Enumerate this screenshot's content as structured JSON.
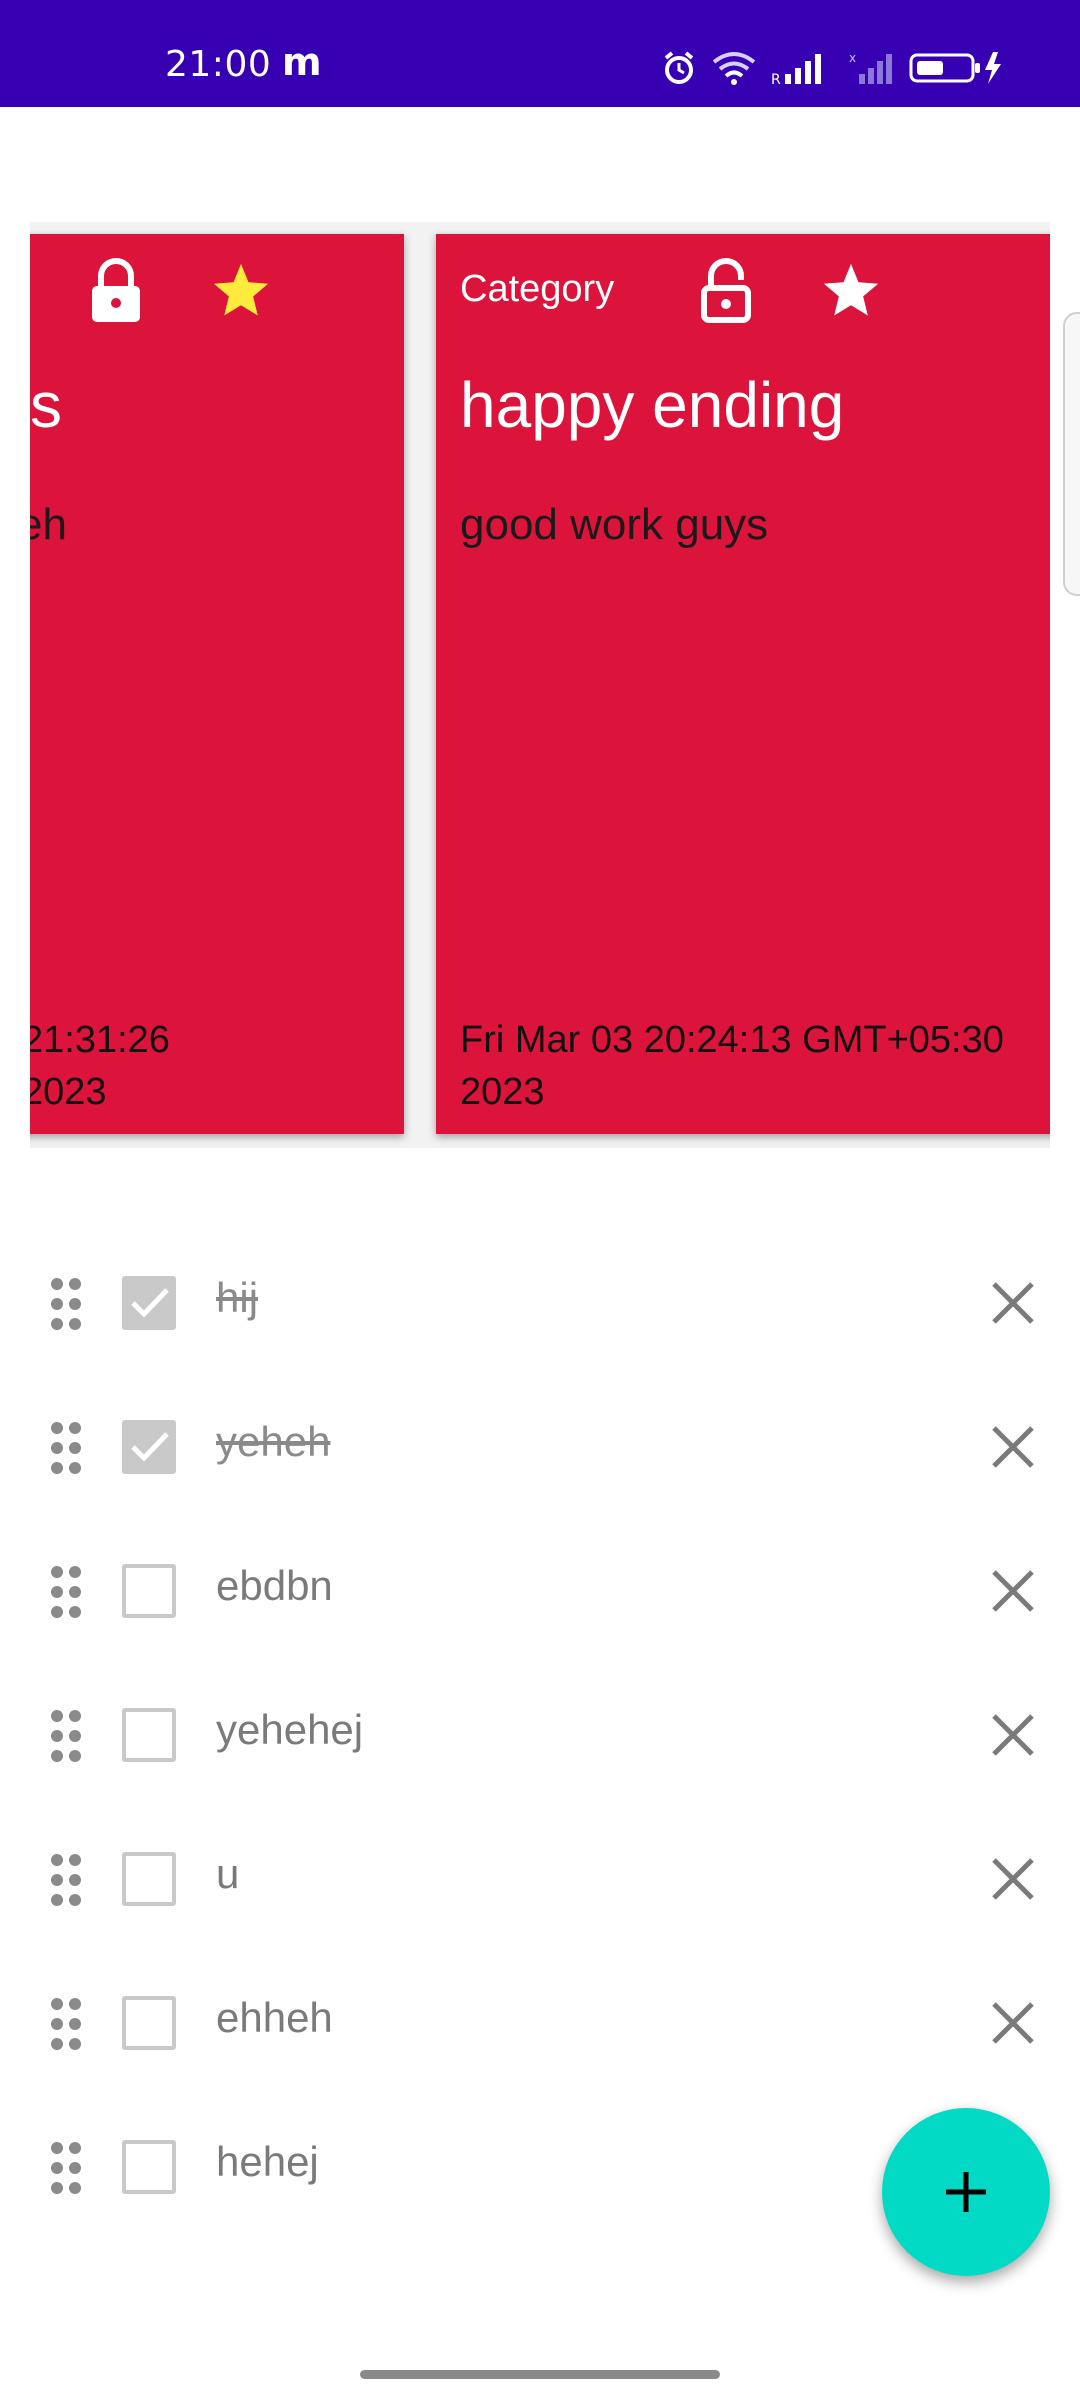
{
  "status_bar": {
    "time": "21:00",
    "app_indicator": "m",
    "icons": [
      "alarm-icon",
      "wifi-icon",
      "signal-r-icon",
      "signal-x-icon",
      "battery-charging-icon"
    ],
    "background": "#3700b3"
  },
  "carousel": {
    "cards": [
      {
        "category": "",
        "title": "s",
        "body": "eh",
        "date_line1": "21:31:26",
        "date_line2": "2023",
        "locked": true,
        "starred": true,
        "star_color": "#ffeb3b"
      },
      {
        "category": "Category",
        "title": "happy ending",
        "body": "good work guys",
        "date_line1": "Fri Mar 03 20:24:13 GMT+05:30",
        "date_line2": "2023",
        "locked": false,
        "starred": true,
        "star_color": "#ffffff"
      }
    ],
    "card_color": "#dc143c"
  },
  "checklist": {
    "items": [
      {
        "text": "hij",
        "checked": true
      },
      {
        "text": "yeheh",
        "checked": true
      },
      {
        "text": "ebdbn",
        "checked": false
      },
      {
        "text": "yehehej",
        "checked": false
      },
      {
        "text": "u",
        "checked": false
      },
      {
        "text": "ehheh",
        "checked": false
      },
      {
        "text": "hehej",
        "checked": false
      }
    ]
  },
  "fab": {
    "icon": "plus-icon",
    "color": "#03dac5"
  }
}
